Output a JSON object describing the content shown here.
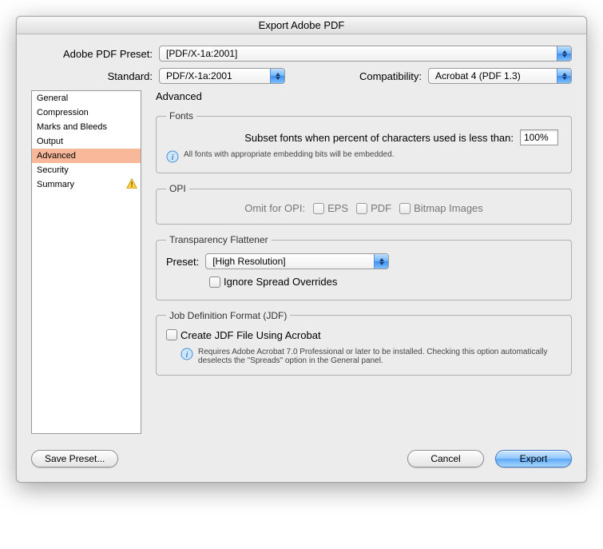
{
  "title": "Export Adobe PDF",
  "labels": {
    "preset": "Adobe PDF Preset:",
    "standard": "Standard:",
    "compatibility": "Compatibility:"
  },
  "selects": {
    "preset": "[PDF/X-1a:2001]",
    "standard": "PDF/X-1a:2001",
    "compatibility": "Acrobat 4 (PDF 1.3)"
  },
  "sidebar": {
    "items": [
      {
        "label": "General"
      },
      {
        "label": "Compression"
      },
      {
        "label": "Marks and Bleeds"
      },
      {
        "label": "Output"
      },
      {
        "label": "Advanced"
      },
      {
        "label": "Security"
      },
      {
        "label": "Summary"
      }
    ],
    "selectedIndex": 4,
    "warningIndex": 6
  },
  "panel": {
    "title": "Advanced",
    "fonts": {
      "legend": "Fonts",
      "subsetLabel": "Subset fonts when percent of characters used is less than:",
      "value": "100%",
      "note": "All fonts with appropriate embedding bits will be embedded."
    },
    "opi": {
      "legend": "OPI",
      "label": "Omit for OPI:",
      "eps": "EPS",
      "pdf": "PDF",
      "bitmap": "Bitmap Images"
    },
    "flattener": {
      "legend": "Transparency Flattener",
      "presetLabel": "Preset:",
      "preset": "[High Resolution]",
      "ignore": "Ignore Spread Overrides"
    },
    "jdf": {
      "legend": "Job Definition Format (JDF)",
      "create": "Create JDF File Using Acrobat",
      "note": "Requires Adobe Acrobat 7.0 Professional or later to be installed. Checking this option automatically deselects the \"Spreads\" option in the General panel."
    }
  },
  "buttons": {
    "savePreset": "Save Preset...",
    "cancel": "Cancel",
    "export": "Export"
  }
}
